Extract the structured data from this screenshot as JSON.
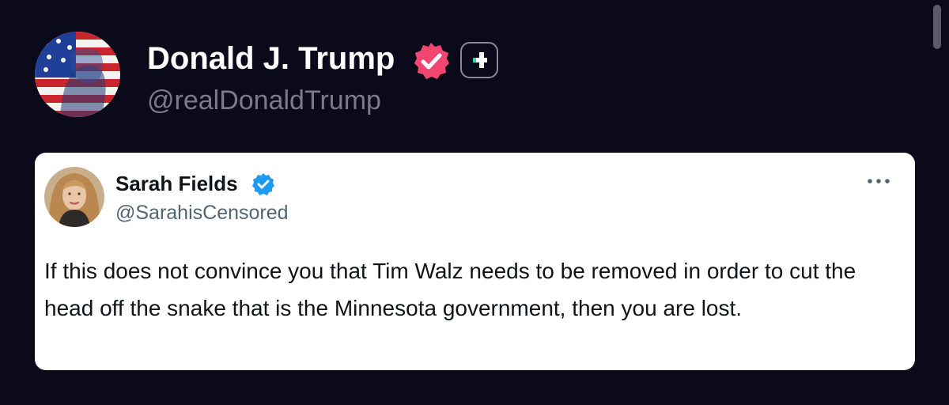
{
  "post": {
    "author_name": "Donald J. Trump",
    "author_handle": "@realDonaldTrump",
    "avatar_icon": "flag-portrait-avatar",
    "verified_icon": "pink-verified-badge",
    "subscribe_icon": "plus-badge-icon"
  },
  "quoted_post": {
    "author_name": "Sarah Fields",
    "author_handle": "@SarahisCensored",
    "avatar_icon": "portrait-avatar",
    "verified_icon": "blue-verified-badge",
    "more_icon": "more-options-icon",
    "text": "If this does not convince you that Tim Walz needs to be removed in order to cut the head off the snake that is the Minnesota government, then you are lost."
  },
  "colors": {
    "background": "#0b0a1a",
    "verified_pink": "#f0466f",
    "verified_blue": "#1d9bf0",
    "plus_green": "#2fd8b6",
    "handle_gray": "#7b7a8a"
  }
}
